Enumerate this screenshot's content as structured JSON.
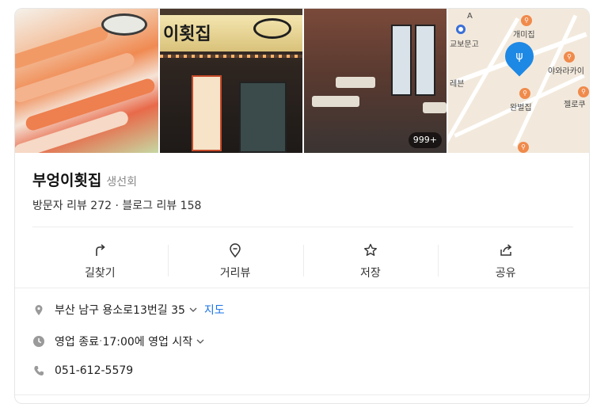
{
  "place": {
    "name": "부엉이횟집",
    "category": "생선회",
    "reviews_text": "방문자 리뷰 272 · 블로그 리뷰 158"
  },
  "photos": {
    "count_badge": "999+",
    "storefront_sign": "이횟집"
  },
  "map": {
    "labels": {
      "gaemi": "개미집",
      "gyobo": "교보문고",
      "yawara": "야와라카이",
      "rebun": "레븐",
      "wanbeol": "완벌집",
      "jellokku": "젤로쿠",
      "a": "A"
    }
  },
  "actions": [
    {
      "label": "길찾기",
      "icon": "directions-icon"
    },
    {
      "label": "거리뷰",
      "icon": "street-view-icon"
    },
    {
      "label": "저장",
      "icon": "star-icon"
    },
    {
      "label": "공유",
      "icon": "share-icon"
    }
  ],
  "info": {
    "address": "부산 남구 용소로13번길 35",
    "map_link": "지도",
    "hours_status": "영업 종료",
    "hours_sep": " · ",
    "hours_detail": "17:00에 영업 시작",
    "phone": "051-612-5579"
  },
  "colors": {
    "link": "#1a73e8",
    "pin": "#1e88e5",
    "poi": "#f08a4b"
  }
}
